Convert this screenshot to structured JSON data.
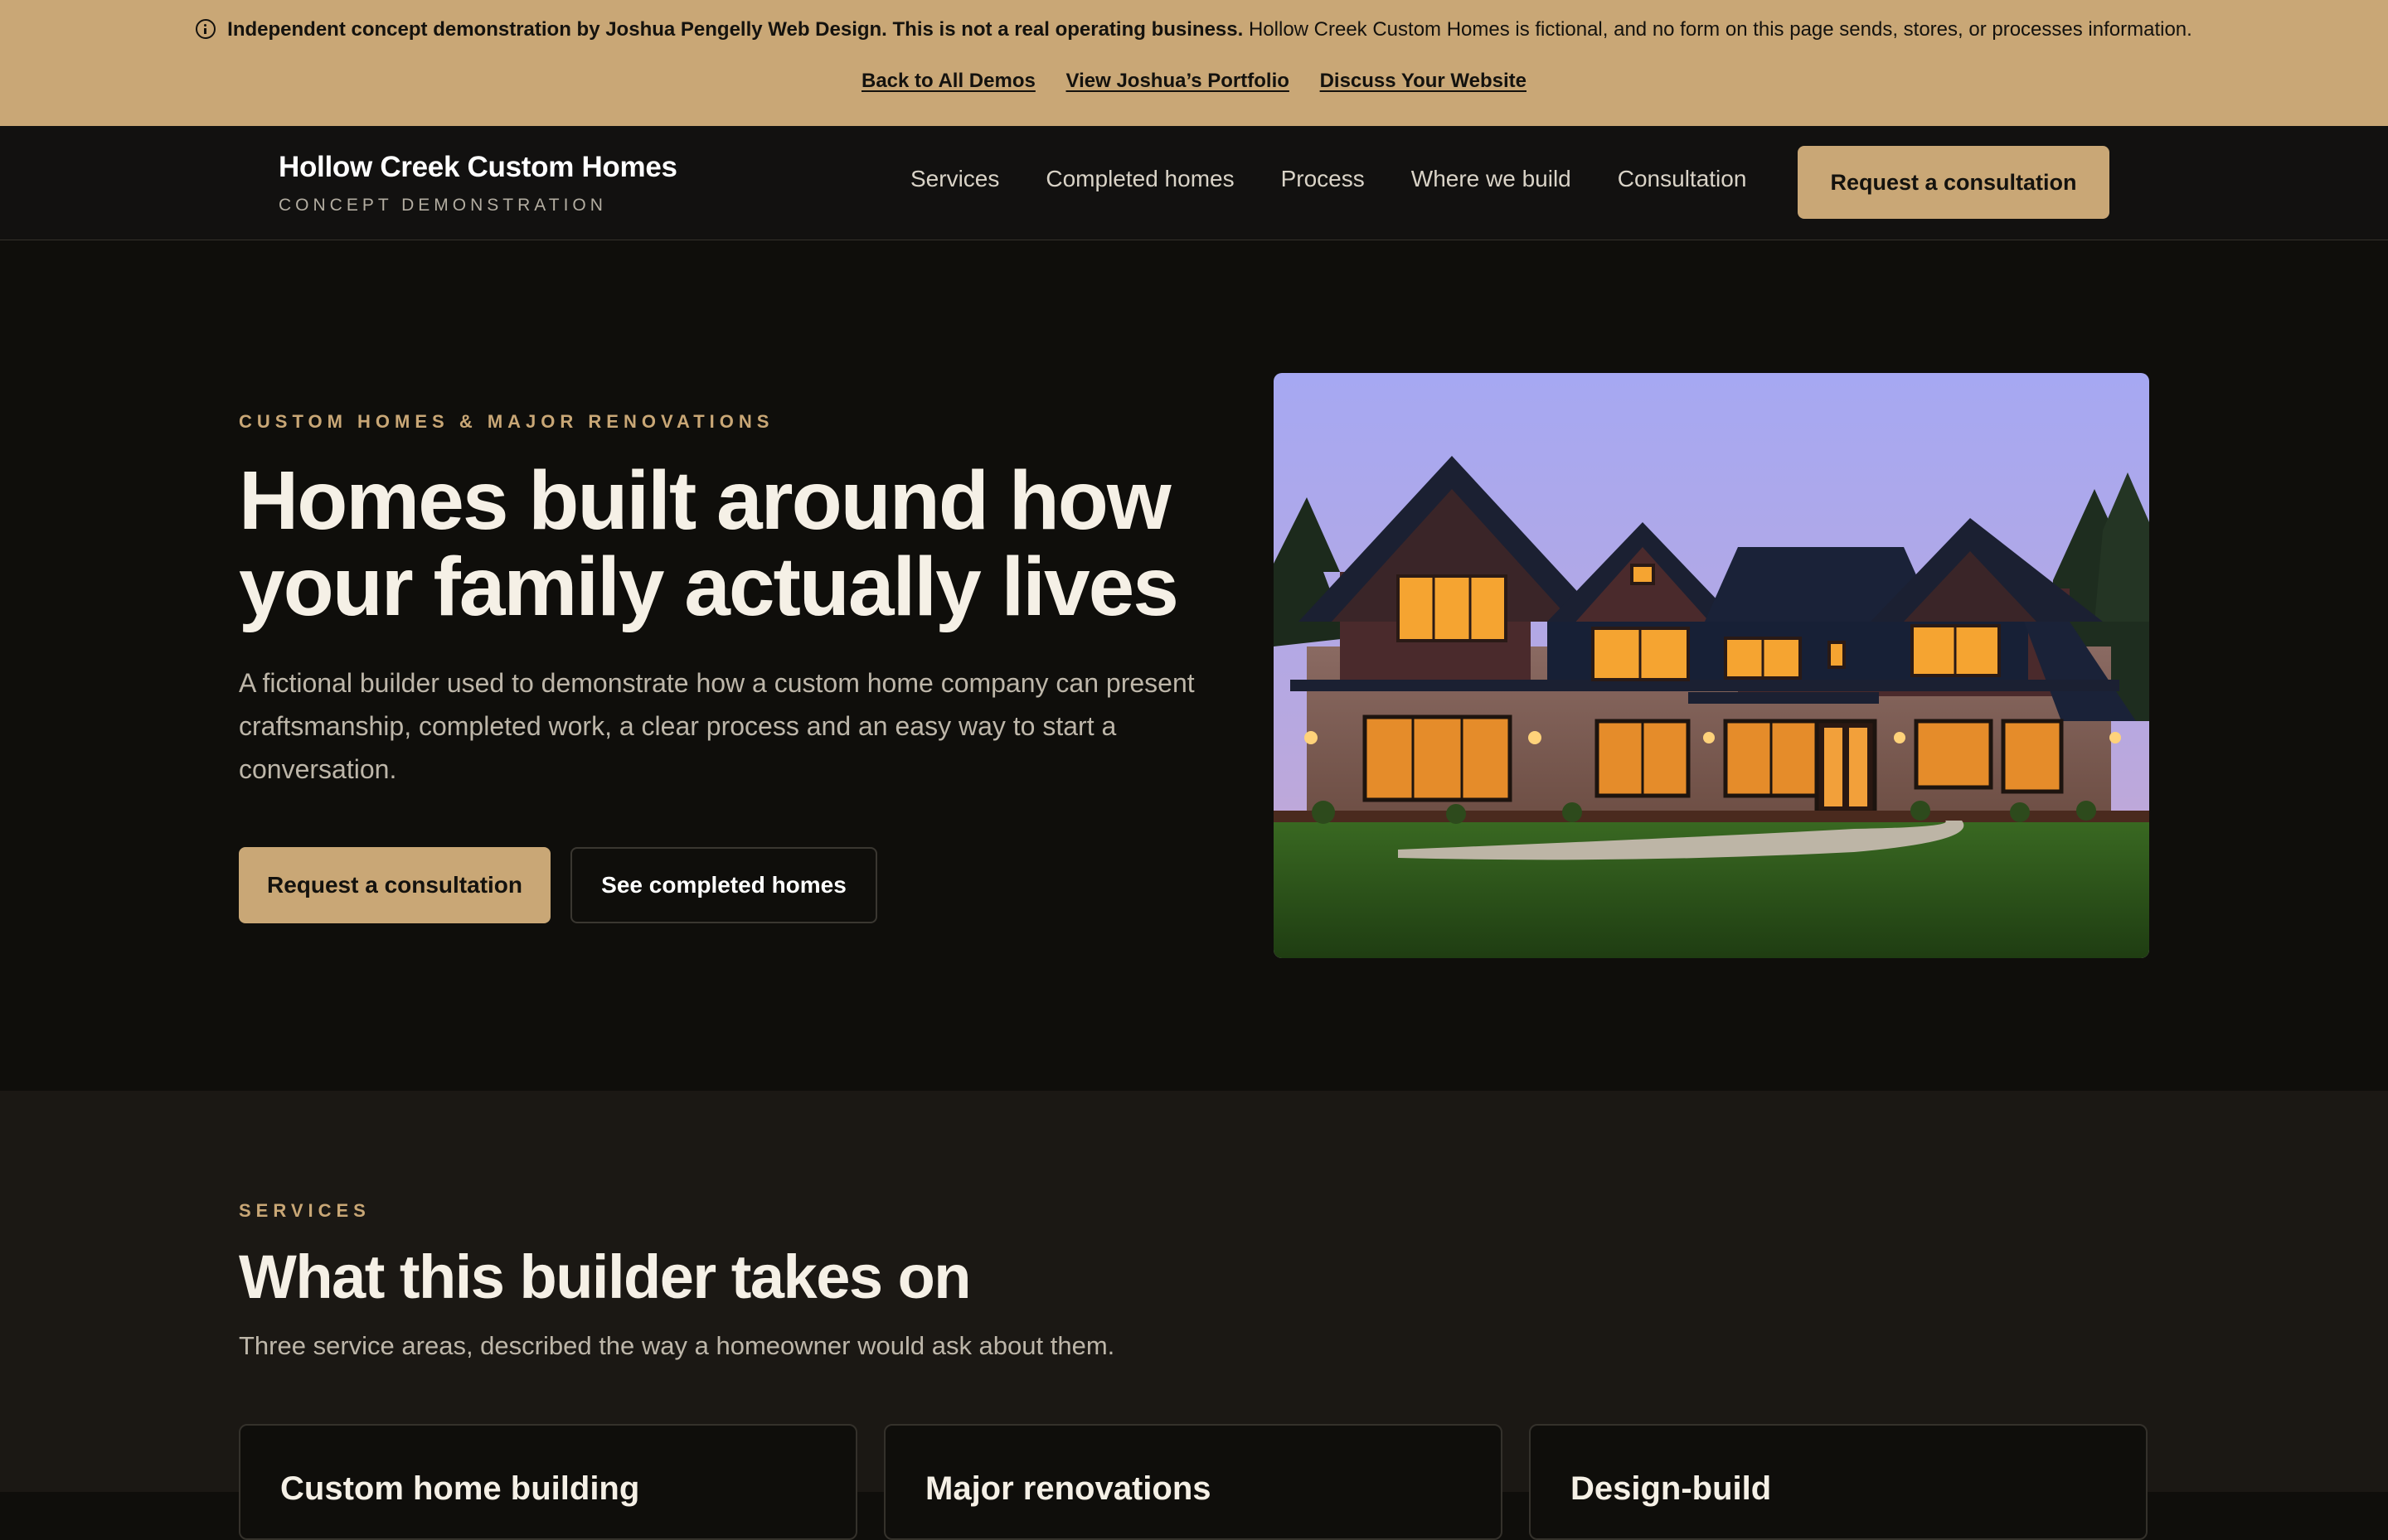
{
  "banner": {
    "icon": "info-icon",
    "bold_text": "Independent concept demonstration by Joshua Pengelly Web Design. This is not a real operating business.",
    "text": "Hollow Creek Custom Homes is fictional, and no form on this page sends, stores, or processes information.",
    "links": [
      "Back to All Demos",
      "View Joshua’s Portfolio",
      "Discuss Your Website"
    ]
  },
  "nav": {
    "brand_name": "Hollow Creek Custom Homes",
    "brand_tag": "CONCEPT DEMONSTRATION",
    "links": [
      "Services",
      "Completed homes",
      "Process",
      "Where we build",
      "Consultation"
    ],
    "cta": "Request a consultation"
  },
  "hero": {
    "eyebrow": "CUSTOM HOMES & MAJOR RENOVATIONS",
    "title": "Homes built around how your family actually lives",
    "subtitle": "A fictional builder used to demonstrate how a custom home company can present craftsmanship, completed work, a clear process and an easy way to start a conversation.",
    "primary_button": "Request a consultation",
    "secondary_button": "See completed homes"
  },
  "services": {
    "eyebrow": "SERVICES",
    "title": "What this builder takes on",
    "subtitle": "Three service areas, described the way a homeowner would ask about them.",
    "cards": [
      "Custom home building",
      "Major renovations",
      "Design-build"
    ]
  },
  "colors": {
    "accent": "#c9a776",
    "background": "#0f0e0b",
    "section_alt": "#1b1814"
  }
}
